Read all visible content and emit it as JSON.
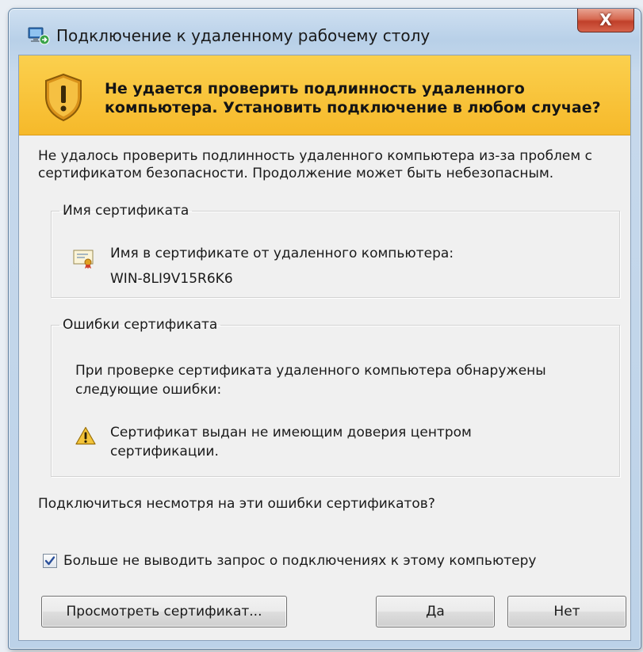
{
  "window": {
    "title": "Подключение к удаленному рабочему столу",
    "close_label": "X"
  },
  "banner": {
    "heading": "Не удается проверить подлинность удаленного компьютера. Установить подключение в любом случае?",
    "icon": "shield-warning-icon",
    "background": "#f8c33b"
  },
  "description": "Не удалось проверить подлинность удаленного компьютера из-за проблем с сертификатом безопасности. Продолжение может быть небезопасным.",
  "certificate_group": {
    "legend": "Имя сертификата",
    "icon": "certificate-icon",
    "label": "Имя в сертификате от удаленного компьютера:",
    "name": "WIN-8LI9V15R6K6"
  },
  "errors_group": {
    "legend": "Ошибки сертификата",
    "intro": "При проверке сертификата удаленного компьютера обнаружены следующие ошибки:",
    "items": [
      {
        "icon": "warning-icon",
        "text": "Сертификат выдан не имеющим доверия центром сертификации."
      }
    ]
  },
  "question": "Подключиться несмотря на эти ошибки сертификатов?",
  "dont_ask": {
    "label": "Больше не выводить запрос о подключениях к этому компьютеру",
    "checked": true
  },
  "buttons": {
    "view_certificate": "Просмотреть сертификат...",
    "yes": "Да",
    "no": "Нет"
  }
}
